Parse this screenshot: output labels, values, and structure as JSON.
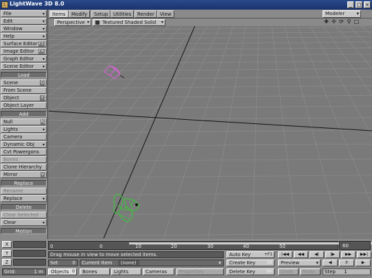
{
  "window": {
    "title": "LightWave 3D 8.0",
    "controls": {
      "minimize": "_",
      "maximize": "□",
      "close": "×"
    },
    "app_icon_glyph": "L"
  },
  "tabs": [
    "Items",
    "Modify",
    "Setup",
    "Utilities",
    "Render",
    "View"
  ],
  "active_tab": "Items",
  "modeler_switch": "Modeler",
  "left_menu": {
    "top": [
      {
        "label": "File",
        "type": "dropdown"
      },
      {
        "label": "Edit",
        "type": "dropdown"
      },
      {
        "label": "Window",
        "type": "dropdown"
      },
      {
        "label": "Help",
        "type": "dropdown"
      },
      {
        "label": "Surface Editor",
        "key": "F5"
      },
      {
        "label": "Image Editor",
        "key": "F6"
      },
      {
        "label": "Graph Editor",
        "type": "dropdown"
      },
      {
        "label": "Scene Editor",
        "type": "dropdown"
      }
    ],
    "load": {
      "header": "Load",
      "items": [
        {
          "label": "Scene",
          "key": "O"
        },
        {
          "label": "From Scene"
        },
        {
          "label": "Object",
          "key": "+"
        },
        {
          "label": "Object Layer"
        }
      ]
    },
    "add": {
      "header": "Add",
      "items": [
        {
          "label": "Null",
          "key": "N"
        },
        {
          "label": "Lights",
          "type": "dropdown"
        },
        {
          "label": "Camera"
        },
        {
          "label": "Dynamic Obj",
          "type": "dropdown"
        },
        {
          "label": "Cvt Powergons"
        },
        {
          "label": "Bones",
          "disabled": true
        },
        {
          "label": "Clone Hierarchy"
        },
        {
          "label": "Mirror",
          "key": "V"
        }
      ]
    },
    "replace": {
      "header": "Replace",
      "items": [
        {
          "label": "Rename",
          "disabled": true
        },
        {
          "label": "Replace",
          "type": "dropdown"
        }
      ]
    },
    "delete": {
      "header": "Delete",
      "items": [
        {
          "label": "Clear Selected",
          "disabled": true
        },
        {
          "label": "Clear",
          "type": "dropdown"
        }
      ]
    },
    "motion_header": "Motion"
  },
  "viewport": {
    "view_mode": "Perspective",
    "shading": "Textured Shaded Solid",
    "controls_icons": [
      "move-view-icon",
      "move-view-alt-icon",
      "rotate-view-icon",
      "zoom-view-icon",
      "maximize-view-icon"
    ],
    "controls_glyphs": [
      "✥",
      "✢",
      "⟳",
      "⚲",
      "□"
    ]
  },
  "timeline": {
    "ticks": [
      "0",
      "10",
      "20",
      "30",
      "40",
      "50"
    ],
    "current": "0",
    "end": "60"
  },
  "axes": [
    "X",
    "Y",
    "Z"
  ],
  "status": {
    "message": "Drag mouse in view to move selected items.",
    "set_label": "Set",
    "set_value": "0",
    "current_item_label": "Current Item",
    "current_item_value": "(none)",
    "grid_label": "Grid:",
    "grid_value": "1 m"
  },
  "item_types": [
    {
      "label": "Objects",
      "count": "0"
    },
    {
      "label": "Bones",
      "count": ""
    },
    {
      "label": "Lights",
      "count": ""
    },
    {
      "label": "Cameras",
      "count": ""
    }
  ],
  "properties_label": "Properties",
  "keys": {
    "auto_key": "Auto Key",
    "auto_key_mod": "+F1",
    "create_key": "Create Key",
    "create_key_shortcut": "ret",
    "delete_key": "Delete Key",
    "delete_key_shortcut": "del"
  },
  "playback": {
    "buttons": [
      "|◀◀",
      "◀◀",
      "◀|",
      "|▶",
      "▶▶",
      "▶▶|"
    ],
    "preview": "Preview",
    "play_reverse": "◀",
    "pause": "II",
    "play": "▶",
    "undo": "Undo",
    "redo": "Redo",
    "step_label": "Step",
    "step_value": "1"
  },
  "colors": {
    "selected_object": "#e060e0",
    "scene_object": "#33cc33",
    "grid": "#909090"
  }
}
